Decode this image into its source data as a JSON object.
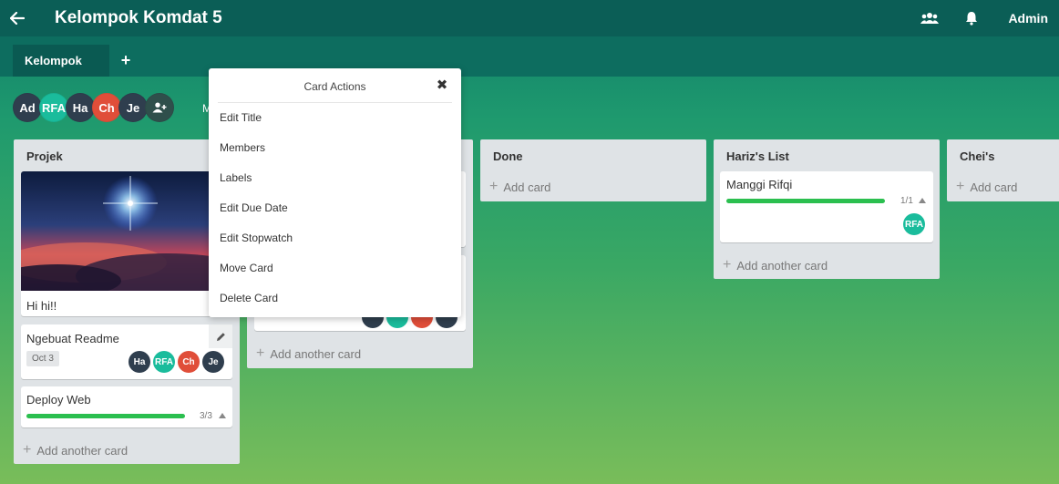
{
  "header": {
    "board_title": "Kelompok Komdat 5",
    "user_label": "Admin"
  },
  "tabs": {
    "active_label": "Kelompok",
    "add_label": "+"
  },
  "members": [
    {
      "initials": "Ad",
      "color": "#2f3e4e"
    },
    {
      "initials": "RFA",
      "color": "#1abc9c"
    },
    {
      "initials": "Ha",
      "color": "#2f3e4e"
    },
    {
      "initials": "Ch",
      "color": "#e04e39"
    },
    {
      "initials": "Je",
      "color": "#2f3e4e"
    }
  ],
  "members_partial_text": "M",
  "lists": {
    "projek": {
      "title": "Projek",
      "cards": [
        {
          "title": "Hi hi!!"
        },
        {
          "title": "Ngebuat Readme",
          "due": "Oct 3",
          "members": [
            "Ha",
            "RFA",
            "Ch",
            "Je"
          ]
        },
        {
          "title": "Deploy Web",
          "checklist": "3/3",
          "progress": 1.0
        }
      ],
      "add_label": "Add another card"
    },
    "second": {
      "add_label": "Add another card"
    },
    "done": {
      "title": "Done",
      "add_label": "Add card"
    },
    "hariz": {
      "title": "Hariz's List",
      "cards": [
        {
          "title": "Manggi Rifqi",
          "checklist": "1/1",
          "progress": 1.0,
          "members": [
            "RFA"
          ]
        }
      ],
      "add_label": "Add another card"
    },
    "chei": {
      "title": "Chei's",
      "add_label": "Add card"
    }
  },
  "card_actions": {
    "title": "Card Actions",
    "items": [
      "Edit Title",
      "Members",
      "Labels",
      "Edit Due Date",
      "Edit Stopwatch",
      "Move Card",
      "Delete Card"
    ]
  },
  "colors": {
    "topbar": "#0b5e56",
    "progress": "#2bbf4f",
    "dark_avatar": "#2f3e4e",
    "teal_avatar": "#1abc9c",
    "red_avatar": "#e04e39"
  },
  "icons": [
    "back-arrow-icon",
    "team-icon",
    "bell-icon",
    "add-member-icon",
    "pencil-icon",
    "close-icon",
    "plus-icon",
    "caret-up-icon"
  ]
}
